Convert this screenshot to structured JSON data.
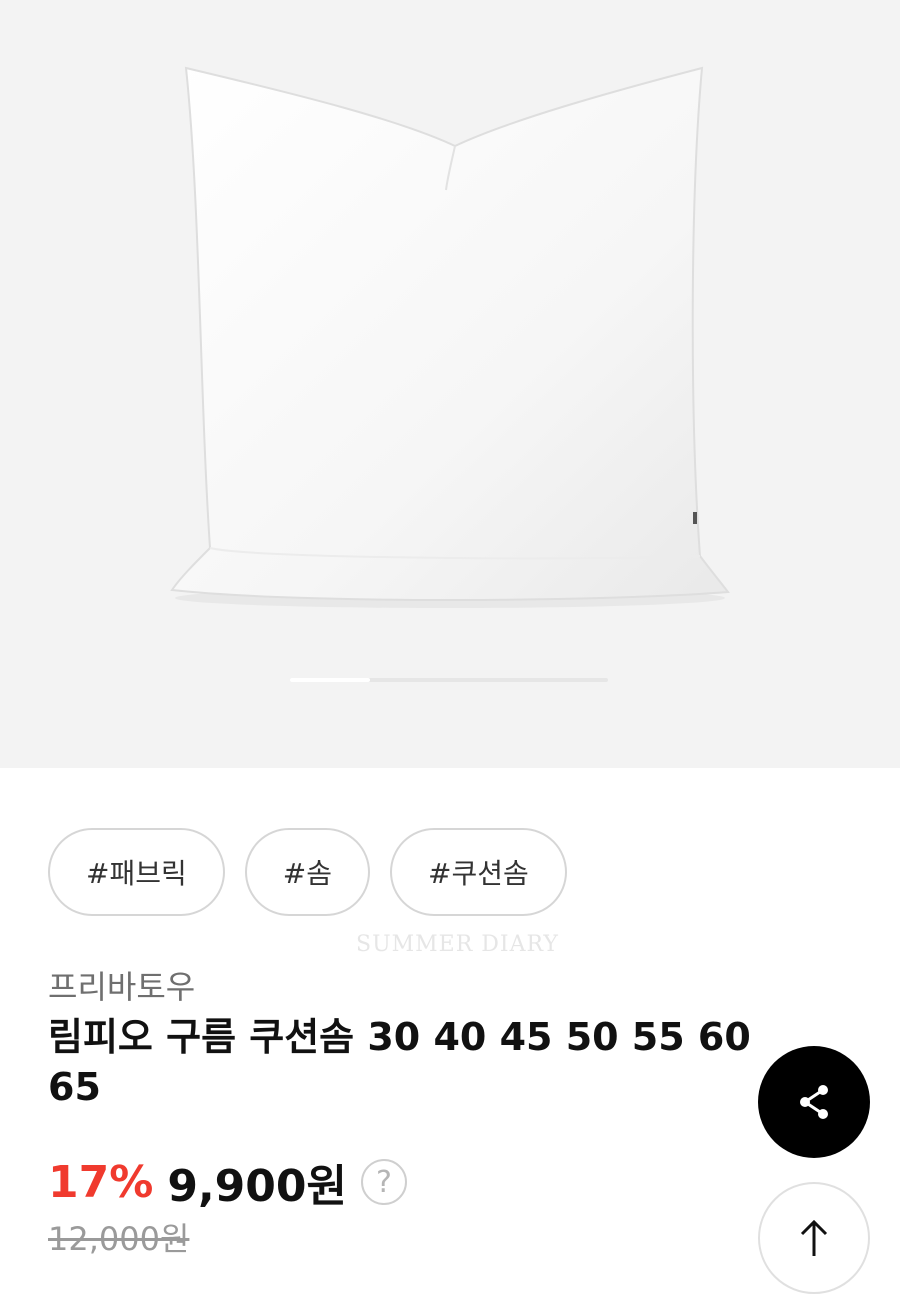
{
  "product_image": {
    "icon": "pillow-image",
    "slide_progress": 0.25
  },
  "tags": [
    "#패브릭",
    "#솜",
    "#쿠션솜"
  ],
  "watermark": "SUMMER DIARY",
  "brand": "프리바토우",
  "title": "림피오 구름 쿠션솜 30 40 45 50 55 60 65",
  "price": {
    "discount": "17%",
    "sale": "9,900원",
    "help": "?",
    "original": "12,000원"
  },
  "colors": {
    "discount": "#f03a2e",
    "hero_bg": "#f3f3f3",
    "share_bg": "#000000"
  },
  "actions": {
    "share_icon": "share-icon",
    "top_icon": "arrow-up-icon"
  }
}
